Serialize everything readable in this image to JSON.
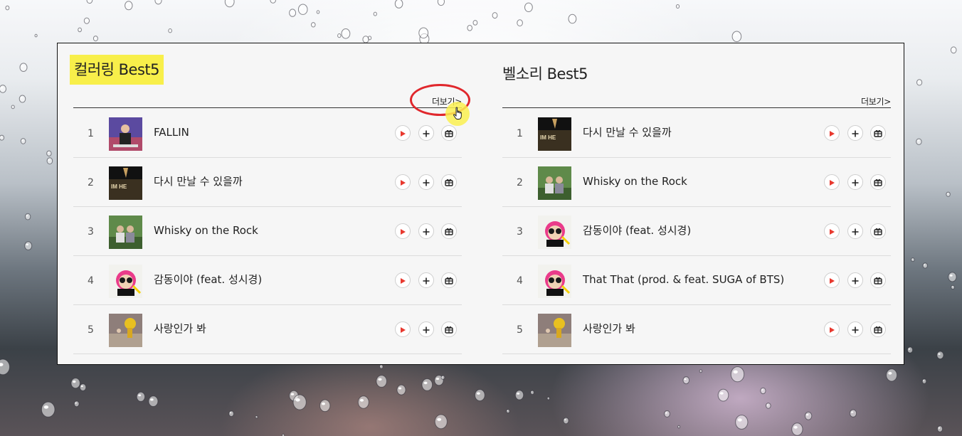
{
  "colors": {
    "highlight": "#f8ef4a",
    "play_red": "#e8392f",
    "annotation_red": "#e0272c"
  },
  "left": {
    "title": "컬러링 Best5",
    "more_label": "더보기>",
    "rows": [
      {
        "rank": "1",
        "title": "FALLIN",
        "art": "art-fallin"
      },
      {
        "rank": "2",
        "title": "다시 만날 수 있을까",
        "art": "art-imhero"
      },
      {
        "rank": "3",
        "title": "Whisky on the Rock",
        "art": "art-whisky"
      },
      {
        "rank": "4",
        "title": "감동이야 (feat. 성시경)",
        "art": "art-psy"
      },
      {
        "rank": "5",
        "title": "사랑인가 봐",
        "art": "art-love"
      }
    ]
  },
  "right": {
    "title": "벨소리 Best5",
    "more_label": "더보기>",
    "rows": [
      {
        "rank": "1",
        "title": "다시 만날 수 있을까",
        "art": "art-imhero"
      },
      {
        "rank": "2",
        "title": "Whisky on the Rock",
        "art": "art-whisky"
      },
      {
        "rank": "3",
        "title": "감동이야 (feat. 성시경)",
        "art": "art-psy"
      },
      {
        "rank": "4",
        "title": "That That (prod. & feat. SUGA of BTS)",
        "art": "art-psy"
      },
      {
        "rank": "5",
        "title": "사랑인가 봐",
        "art": "art-love"
      }
    ]
  },
  "icons": {
    "play": "play-icon",
    "add": "plus-icon",
    "gift": "gift-icon"
  }
}
